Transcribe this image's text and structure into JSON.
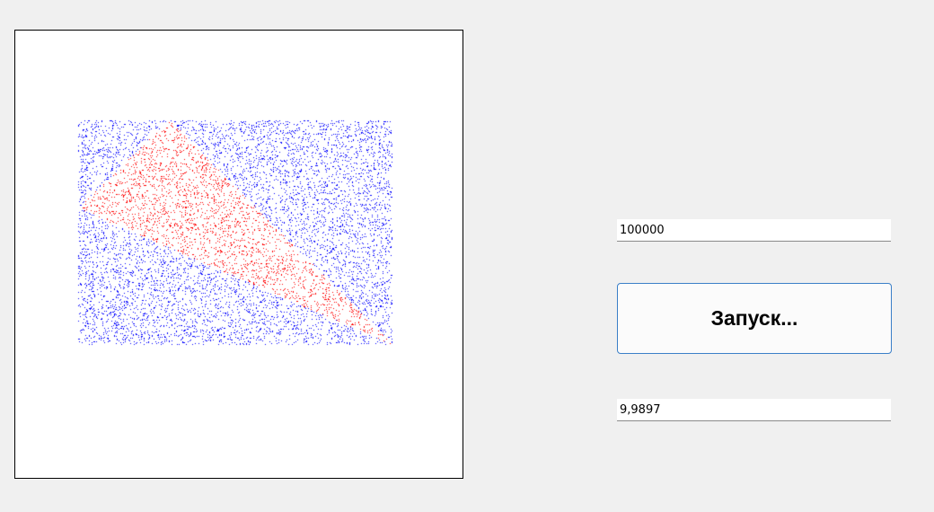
{
  "points_input": {
    "value": "100000"
  },
  "run_button": {
    "label": "Запуск..."
  },
  "result_output": {
    "value": "9,9897"
  },
  "plot": {
    "background_color": "#ffffff",
    "outside_point_color": "#0000ff",
    "inside_point_color": "#ff0000",
    "point_count": 100000
  }
}
